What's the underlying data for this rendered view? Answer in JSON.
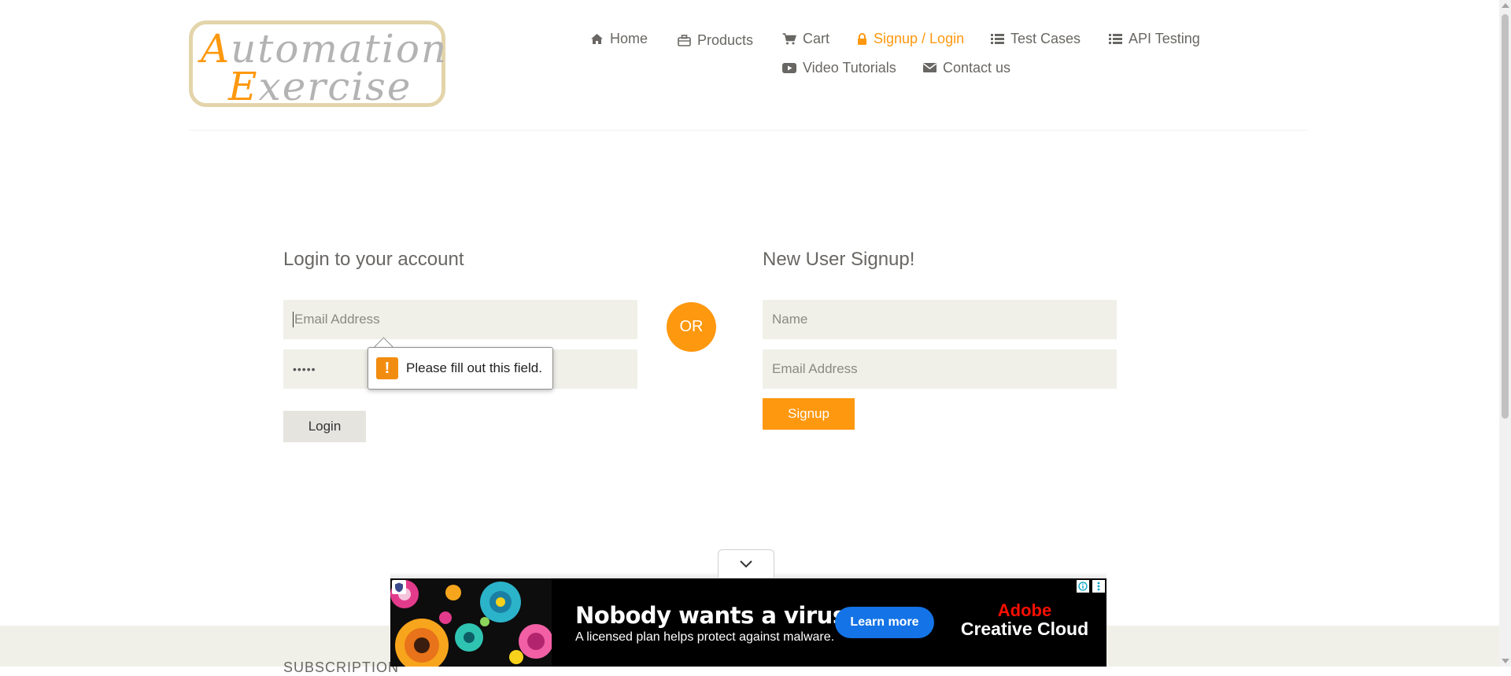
{
  "logo": {
    "line1_cap": "A",
    "line1_rest": "utomation",
    "line2_cap": "E",
    "line2_rest": "xercise"
  },
  "nav": {
    "items": [
      {
        "label": "Home",
        "icon": "home-icon"
      },
      {
        "label": "Products",
        "icon": "briefcase-icon"
      },
      {
        "label": "Cart",
        "icon": "cart-icon"
      },
      {
        "label": "Signup / Login",
        "icon": "lock-icon",
        "active": true
      },
      {
        "label": "Test Cases",
        "icon": "list-icon"
      },
      {
        "label": "API Testing",
        "icon": "list-icon"
      },
      {
        "label": "Video Tutorials",
        "icon": "youtube-play-icon"
      },
      {
        "label": "Contact us",
        "icon": "envelope-icon"
      }
    ]
  },
  "login": {
    "title": "Login to your account",
    "email_placeholder": "Email Address",
    "email_value": "",
    "password_value": "•••••",
    "button": "Login",
    "validation_message": "Please fill out this field."
  },
  "or_label": "OR",
  "signup": {
    "title": "New User Signup!",
    "name_placeholder": "Name",
    "email_placeholder": "Email Address",
    "button": "Signup"
  },
  "footer": {
    "subscription_label": "SUBSCRIPTION"
  },
  "ad": {
    "headline": "Nobody wants a virus.",
    "subtext": "A licensed plan helps protect against malware.",
    "cta": "Learn more",
    "brand_line1": "Adobe",
    "brand_line2": "Creative Cloud"
  },
  "colors": {
    "accent": "#fe980f",
    "field_bg": "#f0f0e9",
    "text": "#696763",
    "ad_button": "#1473e6",
    "adobe_red": "#fa0f00"
  }
}
